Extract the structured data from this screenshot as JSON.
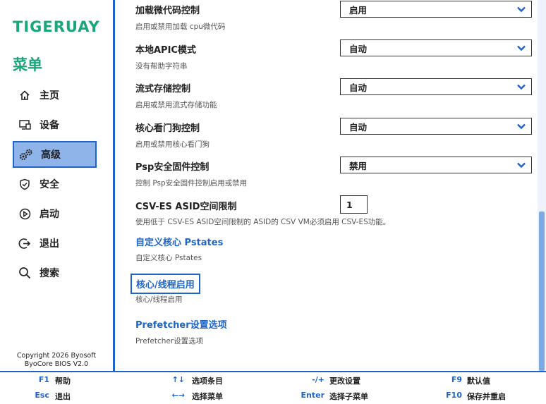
{
  "brand": {
    "logo": "TIGERUAY",
    "menu_title": "菜单"
  },
  "nav": [
    {
      "label": "主页",
      "icon": "home-icon"
    },
    {
      "label": "设备",
      "icon": "device-icon"
    },
    {
      "label": "高级",
      "icon": "gears-icon",
      "active": true
    },
    {
      "label": "安全",
      "icon": "shield-icon"
    },
    {
      "label": "启动",
      "icon": "play-icon"
    },
    {
      "label": "退出",
      "icon": "exit-icon"
    },
    {
      "label": "搜索",
      "icon": "search-icon"
    }
  ],
  "copyright": {
    "line1": "Copyright 2026 Byosoft",
    "line2": "ByoCore BIOS V2.0"
  },
  "options": [
    {
      "title": "加载微代码控制",
      "desc": "启用或禁用加载 cpu微代码",
      "value": "启用"
    },
    {
      "title": "本地APIC模式",
      "desc": "没有帮助字符串",
      "value": "自动"
    },
    {
      "title": "流式存储控制",
      "desc": "启用或禁用流式存储功能",
      "value": "自动"
    },
    {
      "title": "核心看门狗控制",
      "desc": "启用或禁用核心看门狗",
      "value": "自动"
    },
    {
      "title": "Psp安全固件控制",
      "desc": "控制 Psp安全固件控制启用或禁用",
      "value": "禁用"
    }
  ],
  "csv": {
    "title": "CSV-ES ASID空间限制",
    "desc": "使用低于 CSV-ES ASID空间限制的 ASID的 CSV VM必须启用 CSV-ES功能。",
    "value": "1"
  },
  "links": [
    {
      "title": "自定义核心 Pstates",
      "desc": "自定义核心 Pstates"
    },
    {
      "title": "核心/线程启用",
      "desc": "核心/线程启用"
    },
    {
      "title": "Prefetcher设置选项",
      "desc": "Prefetcher设置选项"
    }
  ],
  "hotkeys": [
    {
      "key": "F1",
      "desc": "帮助"
    },
    {
      "key": "Esc",
      "desc": "退出"
    },
    {
      "key": "↑↓",
      "desc": "选项条目"
    },
    {
      "key": "←→",
      "desc": "选择菜单"
    },
    {
      "key": "-/+",
      "desc": "更改设置"
    },
    {
      "key": "Enter",
      "desc": "选择子菜单"
    },
    {
      "key": "F9",
      "desc": "默认值"
    },
    {
      "key": "F10",
      "desc": "保存并重启"
    }
  ],
  "colors": {
    "accent": "#1f64c8",
    "brand": "#1aa67a",
    "active_bg": "#8fb4ea"
  }
}
